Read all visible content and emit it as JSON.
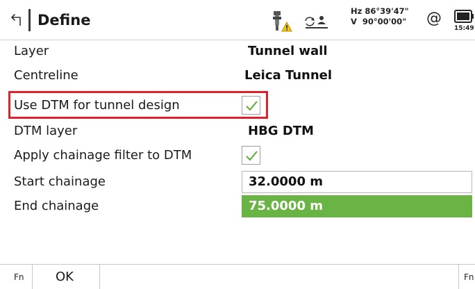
{
  "header": {
    "title": "Define",
    "back_icon": "back-arrow-icon",
    "prism_icon": "prism-warning-icon",
    "mode_icon": "target-mode-icon",
    "hz": "Hz 86°39'47\"",
    "v": "V  90°00'00\"",
    "at_symbol": "@",
    "battery_icon": "battery-icon",
    "time": "15:49"
  },
  "fields": {
    "layer": {
      "label": "Layer",
      "value": "Tunnel wall"
    },
    "centreline": {
      "label": "Centreline",
      "value": "Leica Tunnel"
    },
    "use_dtm": {
      "label": "Use DTM for tunnel design",
      "checked": true
    },
    "dtm_layer": {
      "label": "DTM layer",
      "value": "HBG DTM"
    },
    "apply_filter": {
      "label": "Apply chainage filter to DTM",
      "checked": true
    },
    "start_chainage": {
      "label": "Start chainage",
      "value": "32.0000 m"
    },
    "end_chainage": {
      "label": "End chainage",
      "value": "75.0000 m"
    }
  },
  "softkeys": {
    "fn_left": "Fn",
    "ok": "OK",
    "fn_right": "Fn"
  },
  "colors": {
    "active_field": "#6ab446",
    "highlight_border": "#e0202a",
    "check_mark": "#5aaa3a"
  }
}
